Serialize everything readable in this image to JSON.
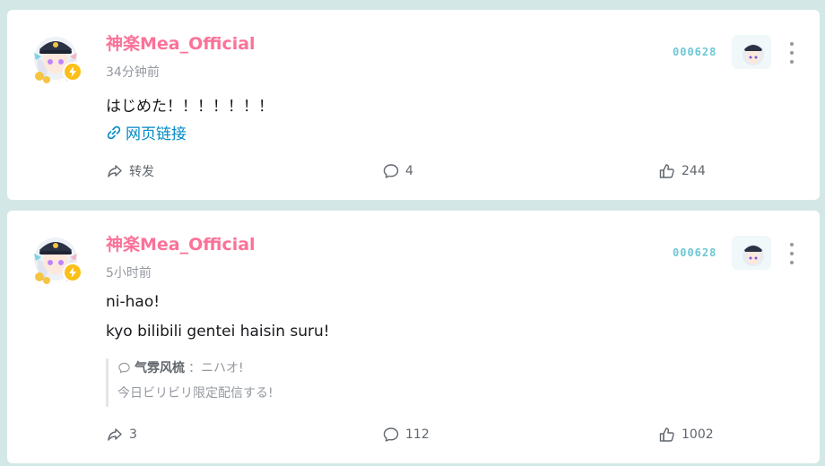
{
  "colors": {
    "background": "#d3e8e6",
    "card": "#ffffff",
    "author_name": "#fb7299",
    "meta_text": "#9499a0",
    "link": "#008ac5",
    "fan_badge": "#6cc7d6",
    "charge_badge": "#fbbf17"
  },
  "posts": [
    {
      "author": "神楽Mea_Official",
      "time": "34分钟前",
      "fan_badge_number": "000628",
      "content": [
        "はじめた！！！！！！！"
      ],
      "link_label": "网页链接",
      "actions": {
        "forward": "转发",
        "comment": "4",
        "like": "244"
      },
      "icons": [
        "avatar",
        "charge-bolt-icon",
        "more-icon",
        "link-icon",
        "share-icon",
        "comment-icon",
        "like-icon"
      ]
    },
    {
      "author": "神楽Mea_Official",
      "time": "5小时前",
      "fan_badge_number": "000628",
      "content": [
        "ni-hao!",
        "kyo bilibili gentei haisin suru!"
      ],
      "quote": {
        "user": "气雰风梳",
        "text": "：ニハオ!",
        "text2": "今日ビリビリ限定配信する!"
      },
      "actions": {
        "forward": "3",
        "comment": "112",
        "like": "1002"
      }
    }
  ]
}
